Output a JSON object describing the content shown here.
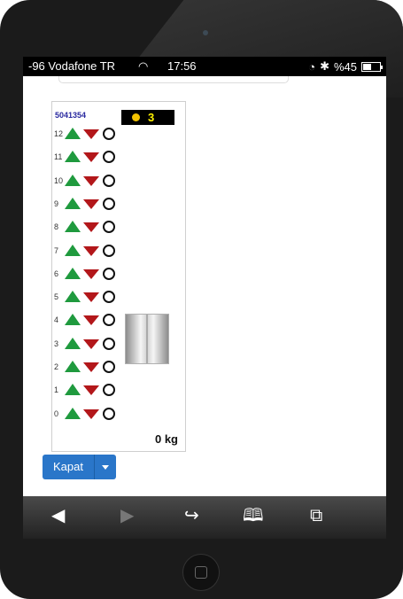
{
  "status_bar": {
    "carrier": "-96 Vodafone TR",
    "time": "17:56",
    "battery": "%45",
    "battery_level": 0.45
  },
  "elevator": {
    "id": "5041354",
    "count": "3",
    "load": "0 kg",
    "floors": [
      "12",
      "11",
      "10",
      "9",
      "8",
      "7",
      "6",
      "5",
      "4",
      "3",
      "2",
      "1",
      "0"
    ]
  },
  "buttons": {
    "close_label": "Kapat"
  },
  "toolbar": {
    "icons": [
      "back-arrow-icon",
      "forward-arrow-icon",
      "share-icon",
      "bookmarks-icon",
      "tabs-icon"
    ]
  },
  "colors": {
    "up": "#1f9a3e",
    "down": "#b3171a",
    "primary_button": "#2a76c9",
    "count_text": "#fff200"
  }
}
